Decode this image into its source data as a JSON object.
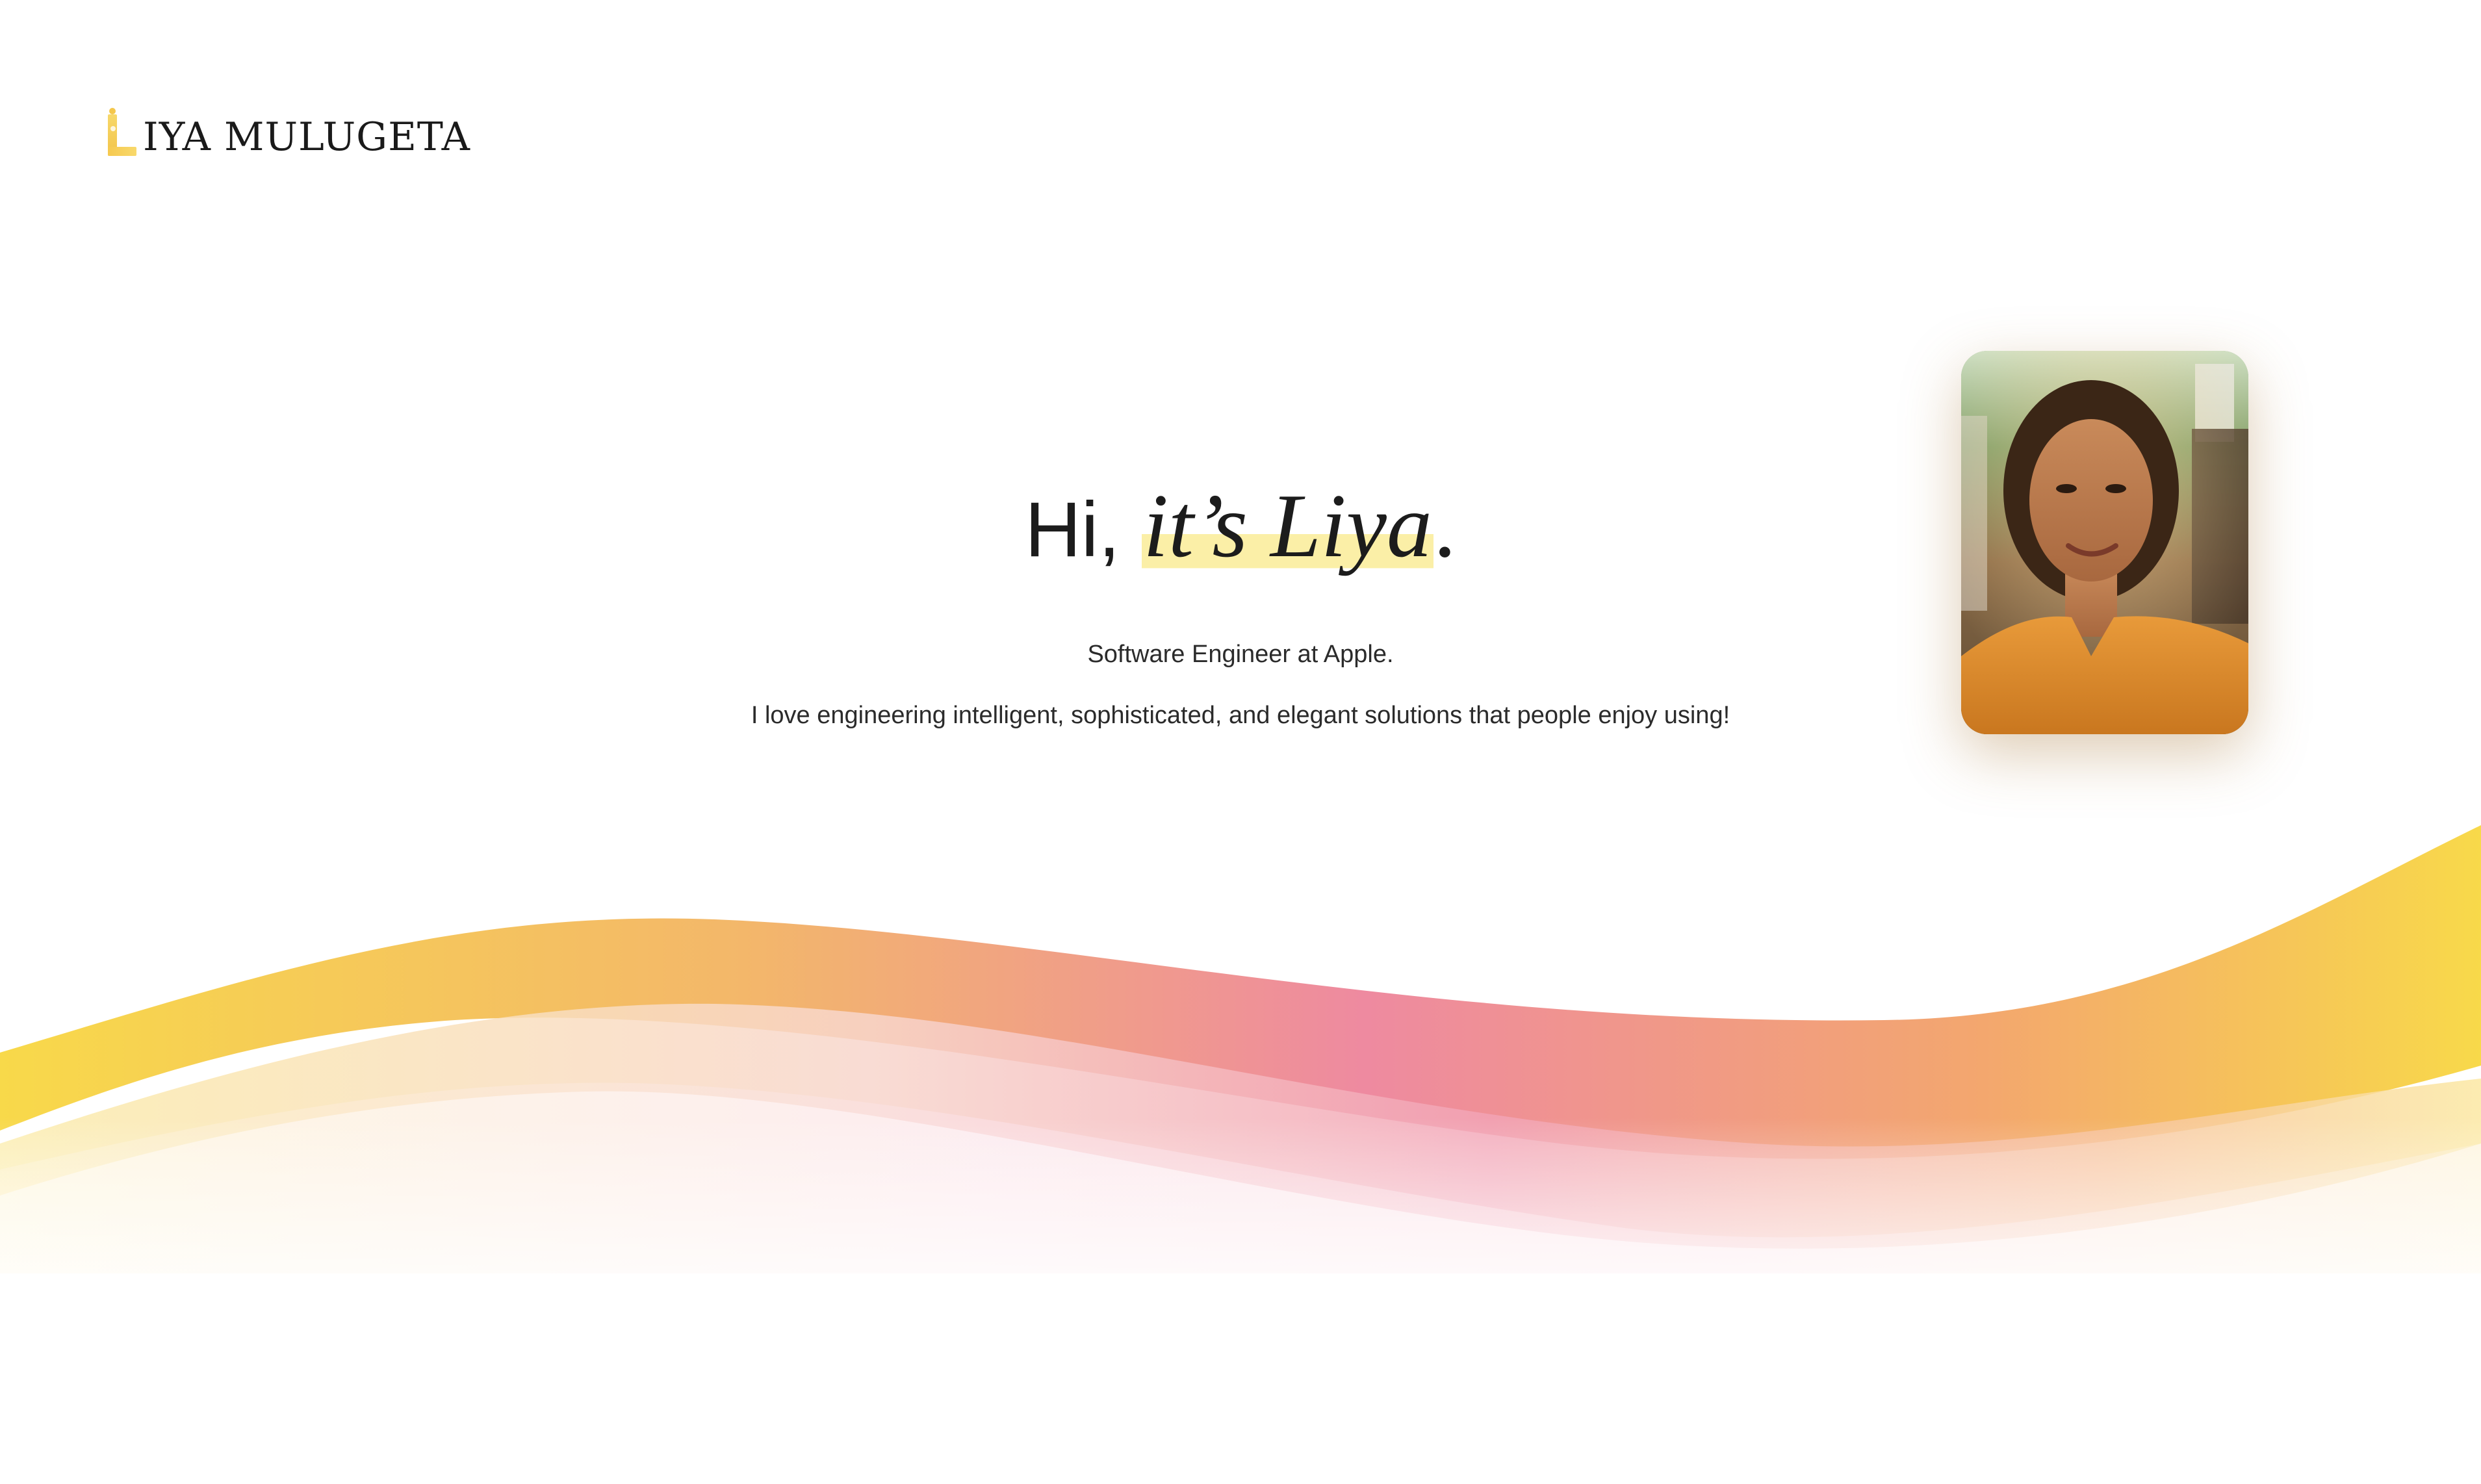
{
  "header": {
    "logo_initial": "L",
    "logo_text": "IYA MULUGETA"
  },
  "hero": {
    "greeting": "Hi,",
    "name_phrase": "it’s Liya",
    "period": ".",
    "role": "Software Engineer at Apple.",
    "bio": "I love engineering intelligent, sophisticated, and elegant solutions that people enjoy using!"
  },
  "portrait": {
    "subject": "portrait photo of a smiling woman in an orange sweater outdoors"
  },
  "colors": {
    "highlight": "#fbefa7",
    "wave_yellow": "#f8d94a",
    "wave_orange": "#f3a76e",
    "wave_pink": "#ee8aa0",
    "text": "#1c1c1c"
  }
}
